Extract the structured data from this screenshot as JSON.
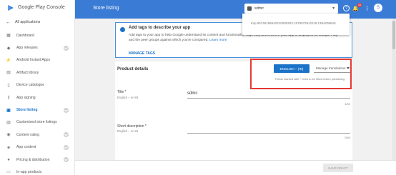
{
  "brand": {
    "text": "Google Play Console"
  },
  "sidebar": {
    "back_label": "All applications",
    "items": [
      {
        "label": "Dashboard",
        "icon": "dashboard-icon",
        "glyph": "▦",
        "check": false,
        "active": false
      },
      {
        "label": "App releases",
        "icon": "rocket-icon",
        "glyph": "◆",
        "check": true,
        "active": false
      },
      {
        "label": "Android Instant Apps",
        "icon": "bolt-icon",
        "glyph": "⚡",
        "check": false,
        "active": false
      },
      {
        "label": "Artifact library",
        "icon": "library-icon",
        "glyph": "▤",
        "check": false,
        "active": false
      },
      {
        "label": "Device catalogue",
        "icon": "phone-icon",
        "glyph": "▯",
        "check": false,
        "active": false
      },
      {
        "label": "App signing",
        "icon": "key-icon",
        "glyph": "⚷",
        "check": false,
        "active": false
      },
      {
        "label": "Store listing",
        "icon": "store-icon",
        "glyph": "▣",
        "check": true,
        "active": true
      },
      {
        "label": "Customised store listings",
        "icon": "custom-listing-icon",
        "glyph": "▥",
        "check": false,
        "active": false
      },
      {
        "label": "Content rating",
        "icon": "rating-icon",
        "glyph": "◉",
        "check": true,
        "active": false
      },
      {
        "label": "App content",
        "icon": "shield-icon",
        "glyph": "◈",
        "check": true,
        "active": false
      },
      {
        "label": "Pricing & distribution",
        "icon": "pricing-icon",
        "glyph": "●",
        "check": true,
        "active": false
      },
      {
        "label": "In-app products",
        "icon": "cart-icon",
        "glyph": "▭",
        "check": false,
        "active": false
      }
    ]
  },
  "header": {
    "title": "Store listing",
    "app_name": "sdmc",
    "badge": "16",
    "avatar": "S"
  },
  "popup": {
    "id_text": "tmp.05746196542210000203.1579572912118.1394205640"
  },
  "info": {
    "title": "Add tags to describe your app",
    "body": "Add tags to your app to help Google understand its content and functionality. Tags may affect where your app is displayed on Google Play, and the peer groups against which you're compared.",
    "link": "Learn more",
    "action": "MANAGE TAGS"
  },
  "product": {
    "title": "Product details",
    "lang_button": "ENGLISH – (IN)",
    "lang_default": "(en-IN)",
    "manage_translations": "Manage translations",
    "fields_note": "Fields marked with * need to be filled before publishing.",
    "title_field": {
      "label": "Title *",
      "sub": "English – en-IN",
      "value": "sdmc",
      "count": "4/50"
    },
    "short_field": {
      "label": "Short description *",
      "sub": "English – en-IN",
      "value": "",
      "count": "0/80"
    }
  },
  "footer": {
    "save": "SAVE DRAFT"
  },
  "colors": {
    "header": "#3a7bd5",
    "accent": "#1a73c8",
    "highlight": "#e53935"
  }
}
